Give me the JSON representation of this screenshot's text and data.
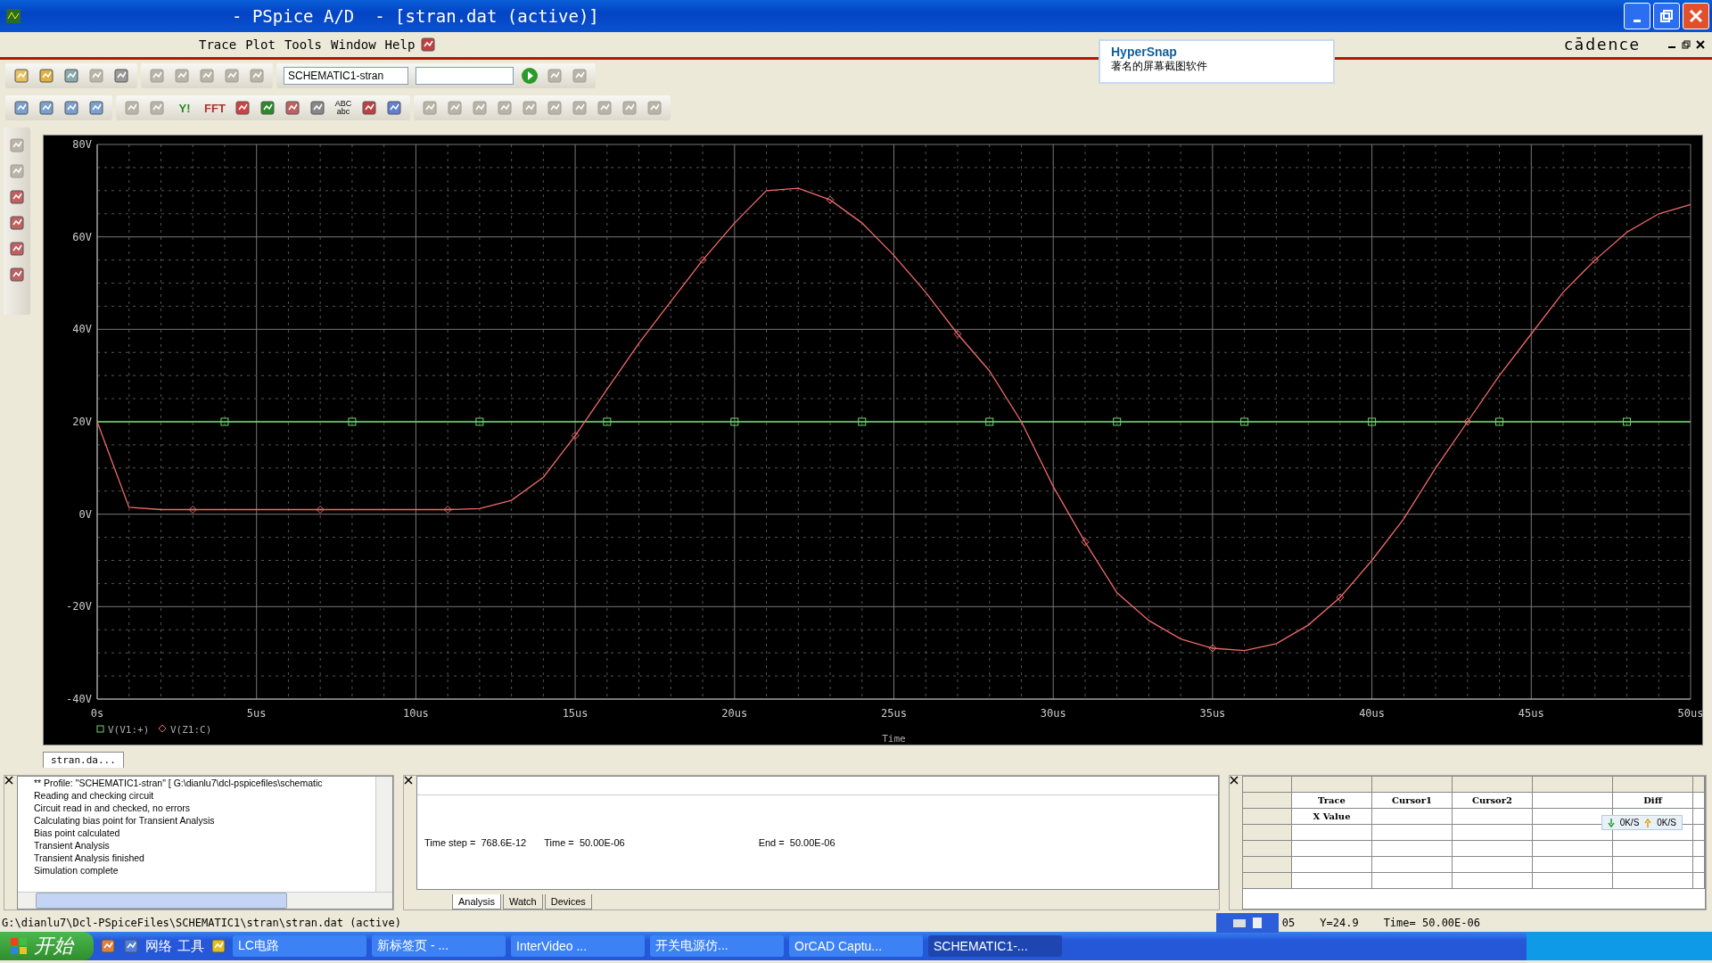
{
  "window": {
    "title": "- PSpice A/D  - [stran.dat (active)]"
  },
  "menu": [
    {
      "label": "Trace"
    },
    {
      "label": "Plot"
    },
    {
      "label": "Tools"
    },
    {
      "label": "Window"
    },
    {
      "label": "Help"
    }
  ],
  "brand": "cādence",
  "popup": {
    "title": "HyperSnap",
    "text": "著名的屏幕截图软件"
  },
  "toolbar": {
    "profile": "SCHEMATIC1-stran",
    "text_buttons": [
      "Y!",
      "FFT",
      "ABC abc"
    ]
  },
  "chart": {
    "chart_data": {
      "type": "line",
      "xlabel": "Time",
      "grid": true,
      "legend": true,
      "xlim": [
        0,
        50
      ],
      "ylim": [
        -40,
        80
      ],
      "x": [
        0,
        1,
        2,
        3,
        4,
        5,
        6,
        7,
        8,
        9,
        10,
        11,
        12,
        13,
        14,
        15,
        16,
        17,
        18,
        19,
        20,
        21,
        22,
        23,
        24,
        25,
        26,
        27,
        28,
        29,
        30,
        31,
        32,
        33,
        34,
        35,
        36,
        37,
        38,
        39,
        40,
        41,
        42,
        43,
        44,
        45,
        46,
        47,
        48,
        49,
        50
      ],
      "xticks": [
        {
          "value": 0,
          "label": "0s"
        },
        {
          "value": 5,
          "label": "5us"
        },
        {
          "value": 10,
          "label": "10us"
        },
        {
          "value": 15,
          "label": "15us"
        },
        {
          "value": 20,
          "label": "20us"
        },
        {
          "value": 25,
          "label": "25us"
        },
        {
          "value": 30,
          "label": "30us"
        },
        {
          "value": 35,
          "label": "35us"
        },
        {
          "value": 40,
          "label": "40us"
        },
        {
          "value": 45,
          "label": "45us"
        },
        {
          "value": 50,
          "label": "50us"
        }
      ],
      "yticks": [
        {
          "value": 80,
          "label": "80V"
        },
        {
          "value": 60,
          "label": "60V"
        },
        {
          "value": 40,
          "label": "40V"
        },
        {
          "value": 20,
          "label": "20V"
        },
        {
          "value": 0,
          "label": "0V"
        },
        {
          "value": -20,
          "label": "-20V"
        },
        {
          "value": -40,
          "label": "-40V"
        }
      ],
      "series": [
        {
          "name": "V(V1:+)",
          "color": "#6fd46f",
          "values": [
            20,
            20,
            20,
            20,
            20,
            20,
            20,
            20,
            20,
            20,
            20,
            20,
            20,
            20,
            20,
            20,
            20,
            20,
            20,
            20,
            20,
            20,
            20,
            20,
            20,
            20,
            20,
            20,
            20,
            20,
            20,
            20,
            20,
            20,
            20,
            20,
            20,
            20,
            20,
            20,
            20,
            20,
            20,
            20,
            20,
            20,
            20,
            20,
            20,
            20,
            20
          ]
        },
        {
          "name": "V(Z1:C)",
          "color": "#f06a6a",
          "values": [
            20,
            1.5,
            1,
            1,
            1,
            1,
            1,
            1,
            1,
            1,
            1,
            1,
            1.2,
            3,
            8,
            17,
            27,
            37,
            46,
            55,
            63,
            70,
            70.5,
            68,
            63,
            56,
            48,
            39,
            31,
            20,
            6,
            -6,
            -17,
            -23,
            -27,
            -29,
            -29.5,
            -28,
            -24,
            -18,
            -10,
            -1,
            10,
            20,
            30,
            39,
            48,
            55,
            61,
            65,
            67
          ]
        }
      ]
    }
  },
  "document_tab": {
    "label": "stran.da..."
  },
  "output_log": {
    "lines": [
      "** Profile: \"SCHEMATIC1-stran\"  [ G:\\dianlu7\\dcl-pspicefiles\\schematic",
      "Reading and checking circuit",
      "Circuit read in and checked, no errors",
      "Calculating bias point for Transient Analysis",
      "Bias point calculated",
      "Transient Analysis",
      "Transient Analysis finished",
      "Simulation complete"
    ]
  },
  "progress_panel": {
    "time_step": "Time step =  768.6E-12",
    "time": "Time =  50.00E-06",
    "end": "End =  50.00E-06",
    "tabs": [
      {
        "label": "Analysis",
        "selected": true
      },
      {
        "label": "Watch",
        "selected": false
      },
      {
        "label": "Devices",
        "selected": false
      }
    ]
  },
  "cursor_table": {
    "columns": [
      "Trace",
      "Cursor1",
      "Cursor2",
      "",
      "Diff"
    ],
    "row_label": "X Value"
  },
  "net_meter": {
    "down": "0K/S",
    "up": "0K/S"
  },
  "status_bar": {
    "path": "G:\\dianlu7\\Dcl-PSpiceFiles\\SCHEMATIC1\\stran\\stran.dat (active)",
    "fragment": "05",
    "y": "Y=24.9",
    "time": "Time= 50.00E-06"
  },
  "taskbar": {
    "start": "开始",
    "quick": [
      {
        "label": "网络"
      },
      {
        "label": "工具"
      }
    ],
    "tasks": [
      {
        "label": "LC电路",
        "selected": false
      },
      {
        "label": "新标签页 - ...",
        "selected": false
      },
      {
        "label": "InterVideo ...",
        "selected": false
      },
      {
        "label": "开关电源仿...",
        "selected": false
      },
      {
        "label": "OrCAD Captu...",
        "selected": false
      },
      {
        "label": "SCHEMATIC1-...",
        "selected": true
      }
    ]
  }
}
